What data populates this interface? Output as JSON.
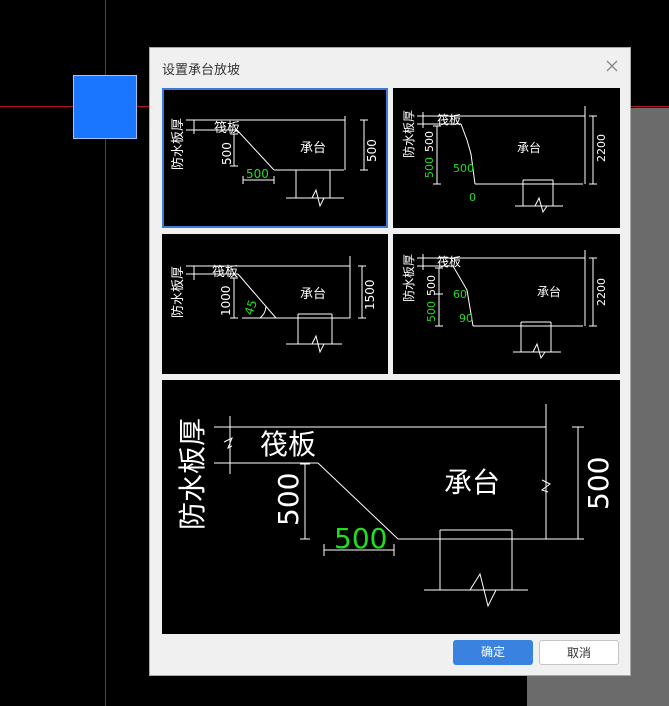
{
  "dialog": {
    "title": "设置承台放坡",
    "ok_label": "确定",
    "cancel_label": "取消"
  },
  "labels": {
    "waterproof": "防水板厚",
    "raft": "筏板",
    "cap": "承台"
  },
  "options": [
    {
      "left_dim": "500",
      "slope_text": "500",
      "right_dim": "500"
    },
    {
      "left_dim": "500",
      "slope_text": "500",
      "bottom_text": "0",
      "right_dim": "2200"
    },
    {
      "left_dim": "1000",
      "angle_text": "45",
      "right_dim": "1500"
    },
    {
      "left_dim_top": "500",
      "left_dim_bottom": "500",
      "angle_top": "60",
      "angle_bottom": "90",
      "right_dim": "2200"
    }
  ],
  "preview": {
    "left_dim": "500",
    "slope_text": "500",
    "right_dim": "500"
  },
  "colors": {
    "accent": "#3a82e0",
    "selection": "#3a7bd5",
    "editable_value": "#22dd22",
    "line": "#ffffff",
    "canvas": "#000000"
  }
}
